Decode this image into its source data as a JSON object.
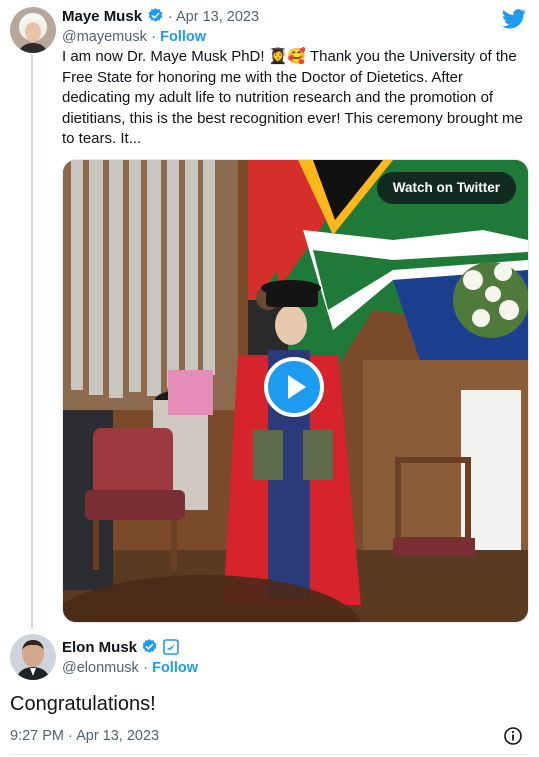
{
  "tweet": {
    "author_name": "Maye Musk",
    "date": "Apr 13, 2023",
    "handle": "@mayemusk",
    "separator": " · ",
    "follow_label": "Follow",
    "text": "I am now Dr. Maye Musk PhD! 👩‍🎓🥰 Thank you the University of the Free State for honoring me with the Doctor of Dietetics. After dedicating my adult life to nutrition research and the promotion of dietitians, this is the best recognition ever! This ceremony brought me to tears. It...",
    "media": {
      "watch_label": "Watch on Twitter",
      "play_icon": "play-icon"
    }
  },
  "reply": {
    "author_name": "Elon Musk",
    "handle": "@elonmusk",
    "separator": " · ",
    "follow_label": "Follow",
    "text": "Congratulations!",
    "timestamp": "9:27 PM · Apr 13, 2023"
  },
  "icons": {
    "twitter": "twitter-bird-icon",
    "verified": "verified-badge-icon",
    "gov_badge": "affiliate-badge-icon",
    "info": "info-icon"
  },
  "colors": {
    "accent": "#1d9bf0",
    "text": "#0f1419",
    "muted": "#536471"
  }
}
